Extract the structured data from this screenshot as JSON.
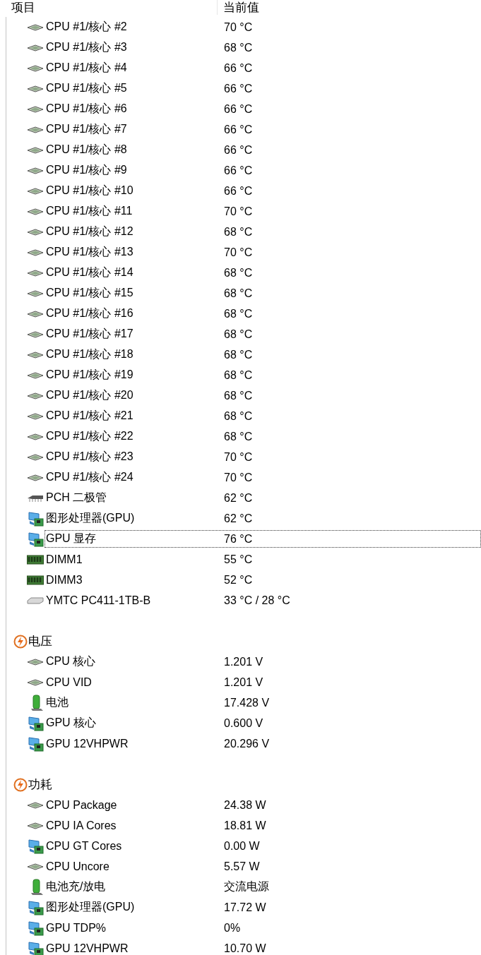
{
  "columns": [
    "项目",
    "当前值"
  ],
  "groups": [
    {
      "rows": [
        {
          "kind": "cpu",
          "label": "CPU #1/核心 #2",
          "value": "70 °C",
          "selected": false
        },
        {
          "kind": "cpu",
          "label": "CPU #1/核心 #3",
          "value": "68 °C",
          "selected": false
        },
        {
          "kind": "cpu",
          "label": "CPU #1/核心 #4",
          "value": "66 °C",
          "selected": false
        },
        {
          "kind": "cpu",
          "label": "CPU #1/核心 #5",
          "value": "66 °C",
          "selected": false
        },
        {
          "kind": "cpu",
          "label": "CPU #1/核心 #6",
          "value": "66 °C",
          "selected": false
        },
        {
          "kind": "cpu",
          "label": "CPU #1/核心 #7",
          "value": "66 °C",
          "selected": false
        },
        {
          "kind": "cpu",
          "label": "CPU #1/核心 #8",
          "value": "66 °C",
          "selected": false
        },
        {
          "kind": "cpu",
          "label": "CPU #1/核心 #9",
          "value": "66 °C",
          "selected": false
        },
        {
          "kind": "cpu",
          "label": "CPU #1/核心 #10",
          "value": "66 °C",
          "selected": false
        },
        {
          "kind": "cpu",
          "label": "CPU #1/核心 #11",
          "value": "70 °C",
          "selected": false
        },
        {
          "kind": "cpu",
          "label": "CPU #1/核心 #12",
          "value": "68 °C",
          "selected": false
        },
        {
          "kind": "cpu",
          "label": "CPU #1/核心 #13",
          "value": "70 °C",
          "selected": false
        },
        {
          "kind": "cpu",
          "label": "CPU #1/核心 #14",
          "value": "68 °C",
          "selected": false
        },
        {
          "kind": "cpu",
          "label": "CPU #1/核心 #15",
          "value": "68 °C",
          "selected": false
        },
        {
          "kind": "cpu",
          "label": "CPU #1/核心 #16",
          "value": "68 °C",
          "selected": false
        },
        {
          "kind": "cpu",
          "label": "CPU #1/核心 #17",
          "value": "68 °C",
          "selected": false
        },
        {
          "kind": "cpu",
          "label": "CPU #1/核心 #18",
          "value": "68 °C",
          "selected": false
        },
        {
          "kind": "cpu",
          "label": "CPU #1/核心 #19",
          "value": "68 °C",
          "selected": false
        },
        {
          "kind": "cpu",
          "label": "CPU #1/核心 #20",
          "value": "68 °C",
          "selected": false
        },
        {
          "kind": "cpu",
          "label": "CPU #1/核心 #21",
          "value": "68 °C",
          "selected": false
        },
        {
          "kind": "cpu",
          "label": "CPU #1/核心 #22",
          "value": "68 °C",
          "selected": false
        },
        {
          "kind": "cpu",
          "label": "CPU #1/核心 #23",
          "value": "70 °C",
          "selected": false
        },
        {
          "kind": "cpu",
          "label": "CPU #1/核心 #24",
          "value": "70 °C",
          "selected": false
        },
        {
          "kind": "chip",
          "label": "PCH 二极管",
          "value": "62 °C",
          "selected": false
        },
        {
          "kind": "gpu",
          "label": "图形处理器(GPU)",
          "value": "62 °C",
          "selected": false
        },
        {
          "kind": "gpu",
          "label": "GPU 显存",
          "value": "76 °C",
          "selected": true
        },
        {
          "kind": "dimm",
          "label": "DIMM1",
          "value": "55 °C",
          "selected": false
        },
        {
          "kind": "dimm",
          "label": "DIMM3",
          "value": "52 °C",
          "selected": false
        },
        {
          "kind": "drive",
          "label": "YMTC PC411-1TB-B",
          "value": "33 °C / 28 °C",
          "selected": false
        }
      ]
    },
    {
      "title": "电压",
      "rows": [
        {
          "kind": "cpu",
          "label": "CPU 核心",
          "value": "1.201 V",
          "selected": false
        },
        {
          "kind": "cpu",
          "label": "CPU VID",
          "value": "1.201 V",
          "selected": false
        },
        {
          "kind": "battery",
          "label": "电池",
          "value": "17.428 V",
          "selected": false
        },
        {
          "kind": "gpu",
          "label": "GPU 核心",
          "value": "0.600 V",
          "selected": false
        },
        {
          "kind": "gpu",
          "label": "GPU 12VHPWR",
          "value": "20.296 V",
          "selected": false
        }
      ]
    },
    {
      "title": "功耗",
      "rows": [
        {
          "kind": "cpu",
          "label": "CPU Package",
          "value": "24.38 W",
          "selected": false
        },
        {
          "kind": "cpu",
          "label": "CPU IA Cores",
          "value": "18.81 W",
          "selected": false
        },
        {
          "kind": "gpu",
          "label": "CPU GT Cores",
          "value": "0.00 W",
          "selected": false
        },
        {
          "kind": "cpu",
          "label": "CPU Uncore",
          "value": "5.57 W",
          "selected": false
        },
        {
          "kind": "battery",
          "label": "电池充/放电",
          "value": "交流电源",
          "selected": false
        },
        {
          "kind": "gpu",
          "label": "图形处理器(GPU)",
          "value": "17.72 W",
          "selected": false
        },
        {
          "kind": "gpu",
          "label": "GPU TDP%",
          "value": "0%",
          "selected": false
        },
        {
          "kind": "gpu",
          "label": "GPU 12VHPWR",
          "value": "10.70 W",
          "selected": false
        }
      ]
    }
  ]
}
